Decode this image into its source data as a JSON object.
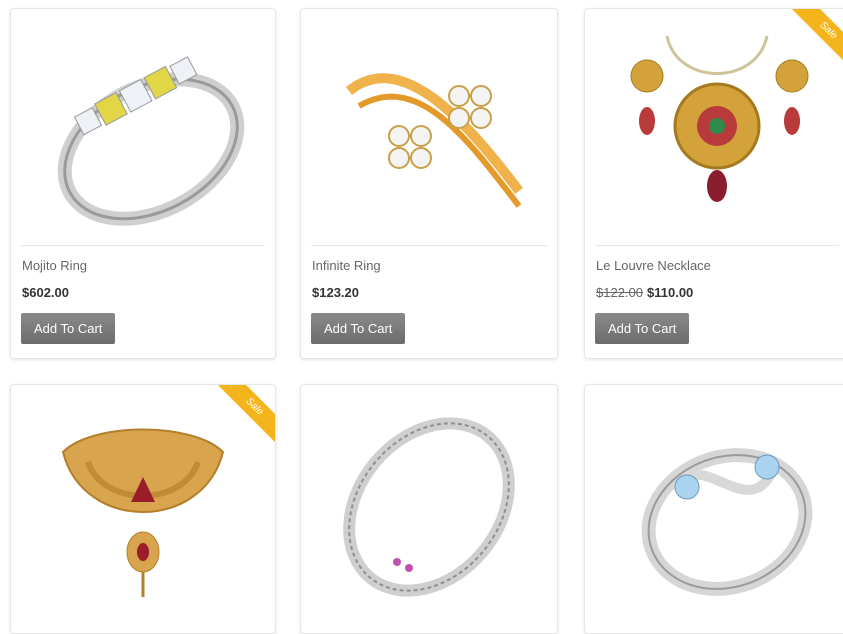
{
  "products": [
    {
      "name": "Mojito Ring",
      "price": "$602.00",
      "old_price": "",
      "button": "Add To Cart",
      "sale": false,
      "image": "ring-yellow-diamond"
    },
    {
      "name": "Infinite Ring",
      "price": "$123.20",
      "old_price": "",
      "button": "Add To Cart",
      "sale": false,
      "image": "ring-gold-cluster"
    },
    {
      "name": "Le Louvre Necklace",
      "price": "$110.00",
      "old_price": "$122.00",
      "button": "Add To Cart",
      "sale": true,
      "sale_label": "Sale",
      "image": "necklace-set"
    },
    {
      "name": "",
      "price": "",
      "old_price": "",
      "button": "",
      "sale": true,
      "sale_label": "Sale",
      "image": "necklace-gold-choker"
    },
    {
      "name": "",
      "price": "",
      "old_price": "",
      "button": "",
      "sale": false,
      "image": "ring-eternity-band"
    },
    {
      "name": "",
      "price": "",
      "old_price": "",
      "button": "",
      "sale": false,
      "image": "ring-twist-diamond"
    }
  ],
  "colors": {
    "button": "#777777",
    "sale_badge": "#f4b51c",
    "price": "#333333",
    "name": "#666666"
  }
}
